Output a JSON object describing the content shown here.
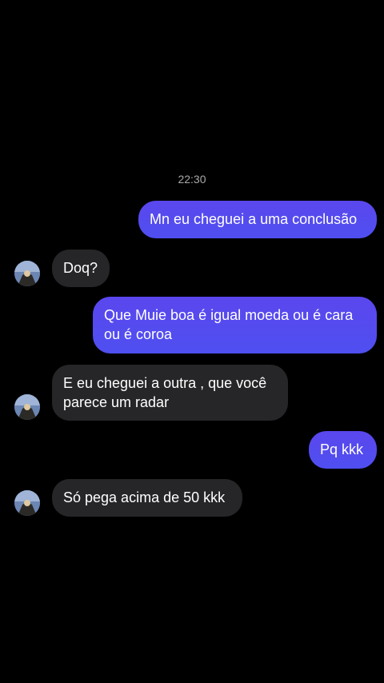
{
  "chat": {
    "timestamp": "22:30",
    "messages": [
      {
        "direction": "outgoing",
        "text": "Mn eu cheguei a uma conclusão"
      },
      {
        "direction": "incoming",
        "text": "Doq?"
      },
      {
        "direction": "outgoing",
        "text": "Que Muie boa é igual moeda ou é cara ou é coroa"
      },
      {
        "direction": "incoming",
        "text": "E eu cheguei a outra , que você parece um radar"
      },
      {
        "direction": "outgoing",
        "text": "Pq kkk"
      },
      {
        "direction": "incoming",
        "text": "Só pega acima de 50 kkk"
      }
    ]
  },
  "colors": {
    "background": "#000000",
    "outgoing_bubble": "#5a47ee",
    "incoming_bubble": "#262629",
    "timestamp_text": "#a9a9ad"
  }
}
